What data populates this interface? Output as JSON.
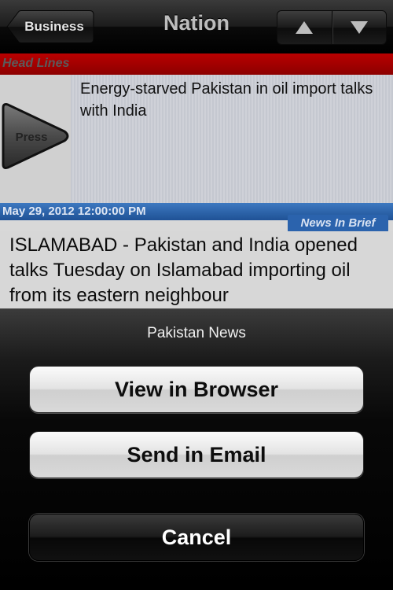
{
  "navbar": {
    "back_label": "Business",
    "title": "Nation"
  },
  "content": {
    "section_label": "Head Lines",
    "headline": "Energy-starved Pakistan in oil import talks with India",
    "thumbnail_text": "Press",
    "date": "May 29, 2012 12:00:00 PM",
    "brief_tag": "News In Brief",
    "story": "ISLAMABAD - Pakistan and India opened talks Tuesday on Islamabad importing oil from its eastern neighbour"
  },
  "action_sheet": {
    "title": "Pakistan News",
    "view_browser_label": "View in Browser",
    "send_email_label": "Send in Email",
    "cancel_label": "Cancel"
  },
  "colors": {
    "section_bar": "#a30000",
    "date_bar": "#2d66ad"
  }
}
